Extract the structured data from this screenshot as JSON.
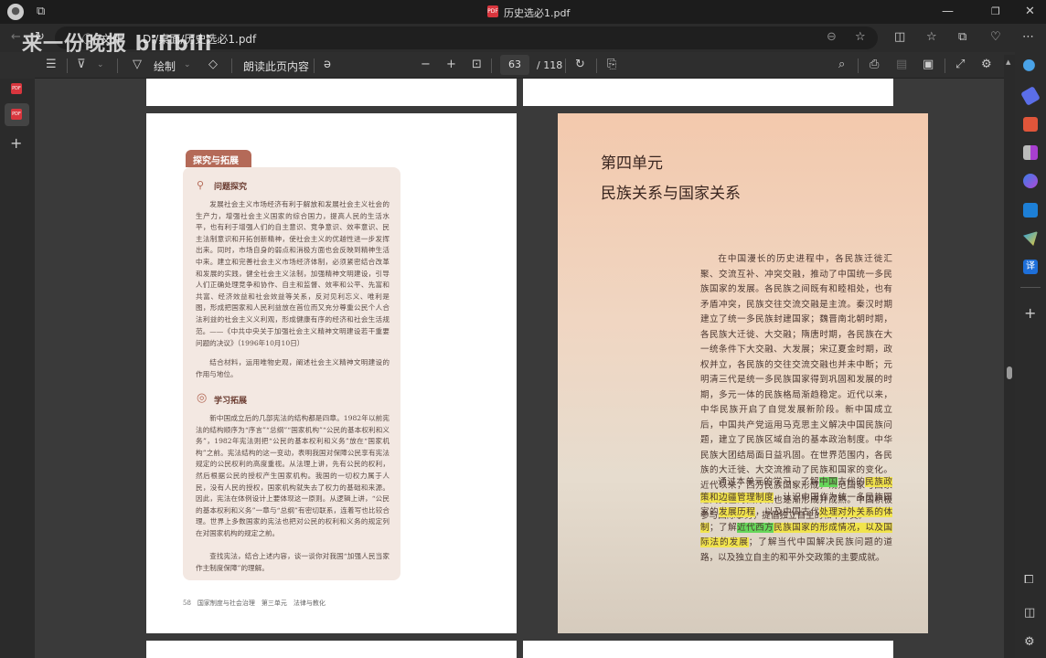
{
  "window": {
    "title": "历史选必1.pdf",
    "minimize": "—",
    "restore": "❐",
    "close": "✕"
  },
  "address": {
    "label": "文件",
    "url": "D:/桌面/历史选必1.pdf"
  },
  "watermark": "来一份晚报 bilibili",
  "toolbar": {
    "draw": "绘制",
    "read_aloud": "朗读此页内容",
    "current_page": "63",
    "total_pages": "/ 118"
  },
  "left_page": {
    "tab": "探究与拓展",
    "section1": "问题探究",
    "p1": "发展社会主义市场经济有利于解放和发展社会主义社会的生产力，增强社会主义国家的综合国力，提高人民的生活水平，也有利于增强人们的自主意识、竞争意识、效率意识、民主法制意识和开拓创新精神，使社会主义的优越性进一步发挥出来。同时，市场自身的弱点和消极方面也会反映到精神生活中来。建立和完善社会主义市场经济体制，必须紧密结合改革和发展的实践，健全社会主义法制，加强精神文明建设，引导人们正确处理竞争和协作、自主和监督、效率和公平、先富和共富、经济效益和社会效益等关系，反对见利忘义、唯利是图，形成把国家和人民利益放在首位而又充分尊重公民个人合法利益的社会主义义利观，形成健康有序的经济和社会生活规范。",
    "citation": "——《中共中央关于加强社会主义精神文明建设若干重要问题的决议》（1996年10月10日）",
    "p2": "结合材料，运用唯物史观，阐述社会主义精神文明建设的作用与地位。",
    "section2": "学习拓展",
    "p3": "新中国成立后的几部宪法的结构都是四章。1982年以前宪法的结构顺序为“序言”“总纲”“国家机构”“公民的基本权利和义务”，1982年宪法则把“公民的基本权利和义务”放在“国家机构”之前。宪法结构的这一变动，表明我国对保障公民享有宪法规定的公民权利的高度重视。从法理上讲，先有公民的权利，然后根据公民的授权产生国家机构。我国的一切权力属于人民，没有人民的授权，国家机构就失去了权力的基础和来源。因此，宪法在体例设计上要体现这一原则。从逻辑上讲，“公民的基本权利和义务”一章与“总纲”有密切联系，连着写也比较合理。世界上多数国家的宪法也把对公民的权利和义务的规定列在对国家机构的规定之前。",
    "p4": "查找宪法，结合上述内容，谈一谈你对我国“加强人民当家作主制度保障”的理解。",
    "footer": "58　国家制度与社会治理　第三单元　法律与教化"
  },
  "right_page": {
    "unit": "第四单元",
    "title": "民族关系与国家关系",
    "p1": "在中国漫长的历史进程中，各民族迁徙汇聚、交流互补、冲突交融，推动了中国统一多民族国家的发展。各民族之间既有和睦相处，也有矛盾冲突，民族交往交流交融是主流。秦汉时期建立了统一多民族封建国家；魏晋南北朝时期，各民族大迁徙、大交融；隋唐时期，各民族在大一统条件下大交融、大发展；宋辽夏金时期，政权并立，各民族的交往交流交融也并未中断；元明清三代是统一多民族国家得到巩固和发展的时期，多元一体的民族格局渐趋稳定。近代以来，中华民族开启了自觉发展新阶段。新中国成立后，中国共产党运用马克思主义解决中国民族问题，建立了民族区域自治的基本政治制度。中华民族大团结局面日益巩固。在世界范围内，各民族的大迁徙、大交流推动了民族和国家的变化。近代以来，西方民族国家形成，规范国家与国家之间交往的国际法也逐渐形成并成熟。中国积极参与国际事务，提倡独立自主的和平外交。",
    "p2": [
      {
        "text": "通过本单元的学习，了解",
        "hl": ""
      },
      {
        "text": "中国",
        "hl": "green"
      },
      {
        "text": "古代的",
        "hl": ""
      },
      {
        "text": "民族政策和边疆管理制度",
        "hl": "yellow"
      },
      {
        "text": "，认识中国作为统一多民族国家的",
        "hl": ""
      },
      {
        "text": "发展历程",
        "hl": "yellow"
      },
      {
        "text": "，以及中国古代",
        "hl": ""
      },
      {
        "text": "处理对外关系的体制",
        "hl": "yellow"
      },
      {
        "text": "；了解",
        "hl": ""
      },
      {
        "text": "近代西方",
        "hl": "green"
      },
      {
        "text": "民族国家的形成情况，以及国际法的发展",
        "hl": "yellow"
      },
      {
        "text": "；了解当代中国解决民族问题的道路，以及独立自主的和平外交政策的主要成就。",
        "hl": ""
      }
    ]
  },
  "colors": {
    "highlight_yellow": "#f1e44d",
    "highlight_green": "#66d75a",
    "tab": "#b46a58"
  }
}
